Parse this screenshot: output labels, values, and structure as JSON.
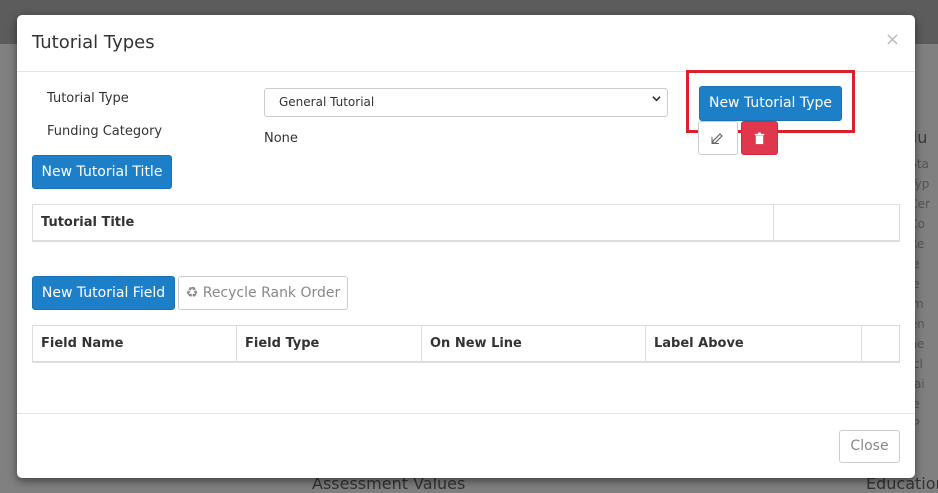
{
  "background": {
    "right_title": "alu",
    "right_list": [
      "e Sta",
      "e Typ",
      "e Cer",
      "e Co",
      "e Re",
      "nce",
      "nce",
      "cem",
      "men",
      "ame",
      "ancl",
      "Chai",
      "nce",
      "al P"
    ],
    "bottom_left": "Assessment Values",
    "bottom_right": "Education"
  },
  "modal": {
    "title": "Tutorial Types",
    "close_glyph": "×",
    "fields": {
      "tutorial_type_label": "Tutorial Type",
      "tutorial_type_value": "General Tutorial",
      "funding_category_label": "Funding Category",
      "funding_category_value": "None"
    },
    "buttons": {
      "new_tutorial_type": "New Tutorial Type",
      "new_tutorial_title": "New Tutorial Title",
      "new_tutorial_field": "New Tutorial Field",
      "recycle_rank_order": "Recycle Rank Order",
      "recycle_icon": "♻",
      "close": "Close"
    },
    "titles_table": {
      "columns": [
        "Tutorial Title",
        ""
      ]
    },
    "fields_table": {
      "columns": [
        "Field Name",
        "Field Type",
        "On New Line",
        "Label Above",
        ""
      ]
    }
  },
  "colors": {
    "primary": "#1d7fc7",
    "danger": "#e0374d",
    "highlight": "#d9212b"
  }
}
